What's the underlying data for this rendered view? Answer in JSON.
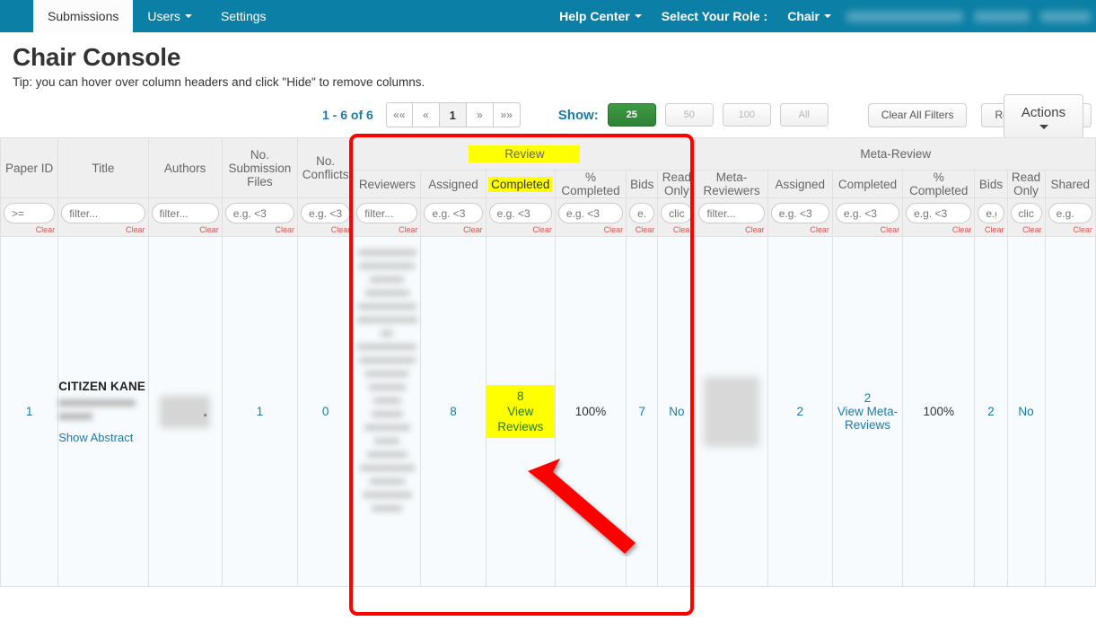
{
  "navbar": {
    "left_items": [
      {
        "label": "Submissions",
        "active": true,
        "caret": false
      },
      {
        "label": "Users",
        "active": false,
        "caret": true
      },
      {
        "label": "Settings",
        "active": false,
        "caret": false
      }
    ],
    "right_items": [
      {
        "label": "Help Center",
        "caret": true
      },
      {
        "label": "Select Your Role :",
        "caret": false
      },
      {
        "label": "Chair",
        "caret": true
      }
    ],
    "background_color": "#0b7fa5"
  },
  "header": {
    "title": "Chair Console",
    "tip": "Tip: you can hover over column headers and click \"Hide\" to remove columns."
  },
  "toolbar": {
    "range_label": "1 - 6 of 6",
    "pager": [
      "««",
      "«",
      "1",
      "»",
      "»»"
    ],
    "current_page": "1",
    "show_label": "Show:",
    "show_options": [
      "25",
      "50",
      "100",
      "All"
    ],
    "show_selected": "25",
    "clear_all_filters": "Clear All Filters",
    "restore_columns": "Restore Columns",
    "actions": "Actions",
    "accent_color": "#1a7ba8",
    "active_green": "#2f8136"
  },
  "table": {
    "group_headers": [
      {
        "label": "Review",
        "highlighted": true,
        "colspan": 6
      },
      {
        "label": "Meta-Review",
        "highlighted": false,
        "colspan": 7
      }
    ],
    "columns": [
      {
        "key": "paper_id",
        "label": "Paper ID",
        "filter": ">= ",
        "highlight": false
      },
      {
        "key": "title",
        "label": "Title",
        "filter": "filter...",
        "highlight": false
      },
      {
        "key": "authors",
        "label": "Authors",
        "filter": "filter...",
        "highlight": false
      },
      {
        "key": "sub_files",
        "label": "No. Submission Files",
        "filter": "e.g. <3",
        "highlight": false
      },
      {
        "key": "conflicts",
        "label": "No. Conflicts",
        "filter": "e.g. <3",
        "highlight": false
      },
      {
        "key": "reviewers",
        "label": "Reviewers",
        "filter": "filter...",
        "highlight": false
      },
      {
        "key": "r_assigned",
        "label": "Assigned",
        "filter": "e.g. <3",
        "highlight": false
      },
      {
        "key": "r_completed",
        "label": "Completed",
        "filter": "e.g. <3",
        "highlight": true
      },
      {
        "key": "r_percent",
        "label": "% Completed",
        "filter": "e.g. <3",
        "highlight": false
      },
      {
        "key": "r_bids",
        "label": "Bids",
        "filter": "e.g",
        "highlight": false
      },
      {
        "key": "r_readonly",
        "label": "Read Only",
        "filter": "clic",
        "highlight": false
      },
      {
        "key": "m_reviewers",
        "label": "Meta-Reviewers",
        "filter": "filter...",
        "highlight": false
      },
      {
        "key": "m_assigned",
        "label": "Assigned",
        "filter": "e.g. <3",
        "highlight": false
      },
      {
        "key": "m_completed",
        "label": "Completed",
        "filter": "e.g. <3",
        "highlight": false
      },
      {
        "key": "m_percent",
        "label": "% Completed",
        "filter": "e.g. <3",
        "highlight": false
      },
      {
        "key": "m_bids",
        "label": "Bids",
        "filter": "e.g",
        "highlight": false
      },
      {
        "key": "m_readonly",
        "label": "Read Only",
        "filter": "clic",
        "highlight": false
      },
      {
        "key": "m_shared",
        "label": "Shared",
        "filter": "e.g. ",
        "highlight": false
      }
    ],
    "clear_label": "Clear",
    "row": {
      "paper_id": "1",
      "title": "CITIZEN KANE",
      "show_abstract": "Show Abstract",
      "sub_files": "1",
      "conflicts": "0",
      "r_assigned": "8",
      "r_completed_count": "8",
      "r_completed_link": "View Reviews",
      "r_percent": "100%",
      "r_bids": "7",
      "r_readonly": "No",
      "m_assigned": "2",
      "m_completed_count": "2",
      "m_completed_link": "View Meta-Reviews",
      "m_percent": "100%",
      "m_bids": "2",
      "m_readonly": "No",
      "m_shared": ""
    }
  },
  "annotation": {
    "box_color": "#ff0000",
    "arrow_color": "#ff0000",
    "highlight_color": "#ffff00"
  }
}
